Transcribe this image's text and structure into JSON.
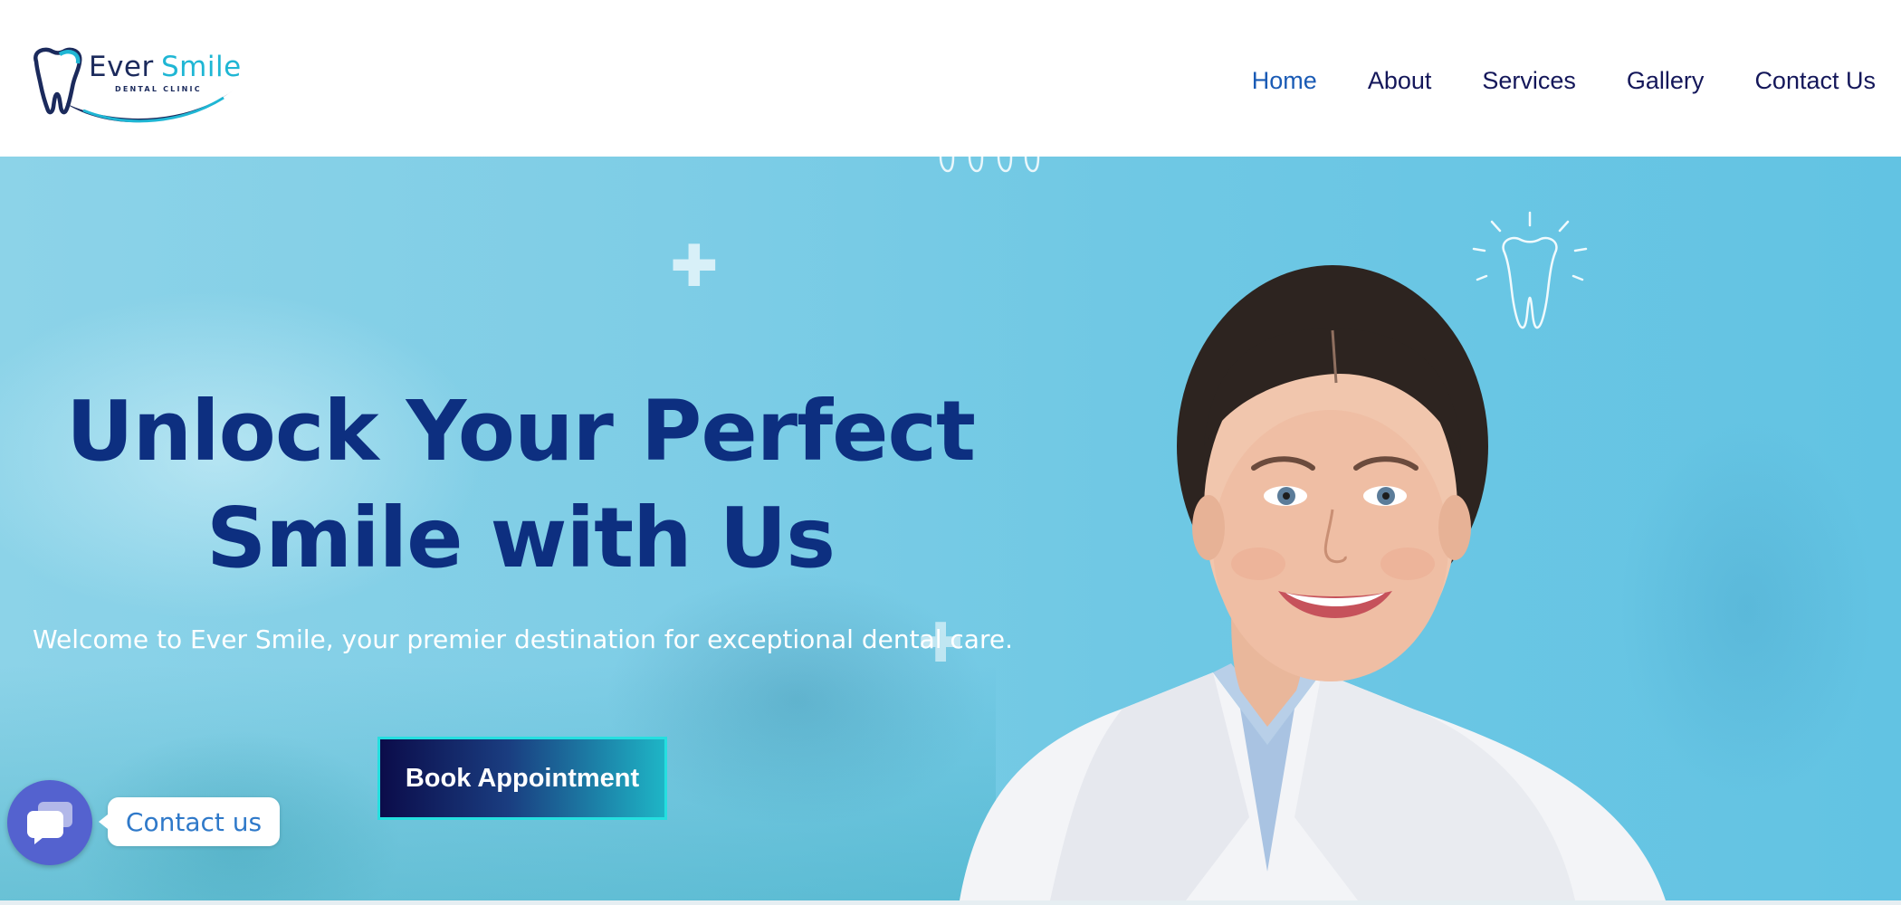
{
  "brand": {
    "name_part1": "Ever",
    "name_part2": "Smile",
    "tagline": "DENTAL CLINIC"
  },
  "nav": {
    "items": [
      {
        "label": "Home",
        "active": true
      },
      {
        "label": "About",
        "active": false
      },
      {
        "label": "Services",
        "active": false
      },
      {
        "label": "Gallery",
        "active": false
      },
      {
        "label": "Contact Us",
        "active": false
      }
    ]
  },
  "hero": {
    "headline_line1": "Unlock Your Perfect",
    "headline_line2": "Smile with Us",
    "subtext": "Welcome to Ever Smile, your premier destination for exceptional dental care.",
    "cta_label": "Book Appointment"
  },
  "chat": {
    "label": "Contact us",
    "icon": "chat-icon"
  },
  "colors": {
    "navy": "#0d2f80",
    "nav_text": "#14175a",
    "nav_active": "#1a5bb5",
    "accent_cyan": "#1fb6d4",
    "hero_bg": "#7ecde6",
    "chat_button": "#5462cf"
  }
}
